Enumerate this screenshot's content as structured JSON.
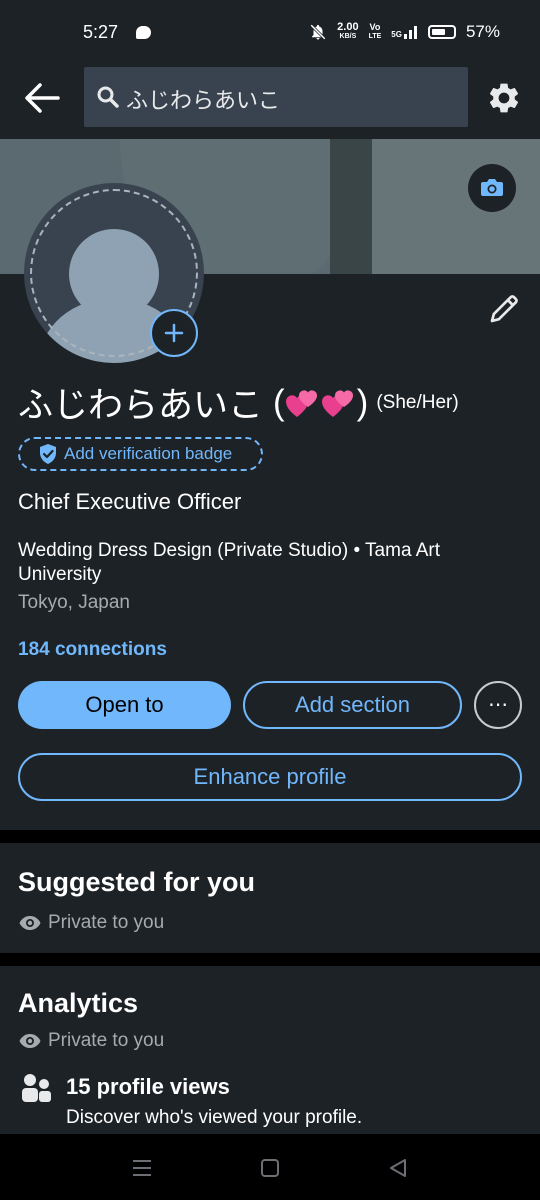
{
  "status_bar": {
    "time": "5:27",
    "speed_value": "2.00",
    "speed_unit": "KB/S",
    "vo_label": "Vo",
    "lte_label": "LTE",
    "network": "5G",
    "battery_percent": "57%"
  },
  "top_bar": {
    "search_text": "ふじわらあいこ",
    "icons": [
      "back-arrow-icon",
      "search-icon",
      "gear-icon"
    ]
  },
  "profile": {
    "name": "ふじわらあいこ",
    "name_suffix_open": "(",
    "name_suffix_close": ")",
    "heart_count": 2,
    "pronouns": "(She/Her)",
    "verification_badge_label": "Add verification badge",
    "headline": "Chief Executive Officer",
    "organization": "Wedding Dress Design (Private Studio) • Tama Art University",
    "location": "Tokyo, Japan",
    "connections": "184 connections",
    "buttons": {
      "open_to": "Open to",
      "add_section": "Add section",
      "more": "⋯",
      "enhance": "Enhance profile"
    }
  },
  "suggested": {
    "title": "Suggested for you",
    "privacy": "Private to you"
  },
  "analytics": {
    "title": "Analytics",
    "privacy": "Private to you",
    "views_title": "15 profile views",
    "views_subtitle": "Discover who's viewed your profile."
  },
  "colors": {
    "accent": "#71b7fb",
    "card_bg": "#1d2226",
    "page_bg": "#000000",
    "muted_text": "#a6abaf"
  }
}
